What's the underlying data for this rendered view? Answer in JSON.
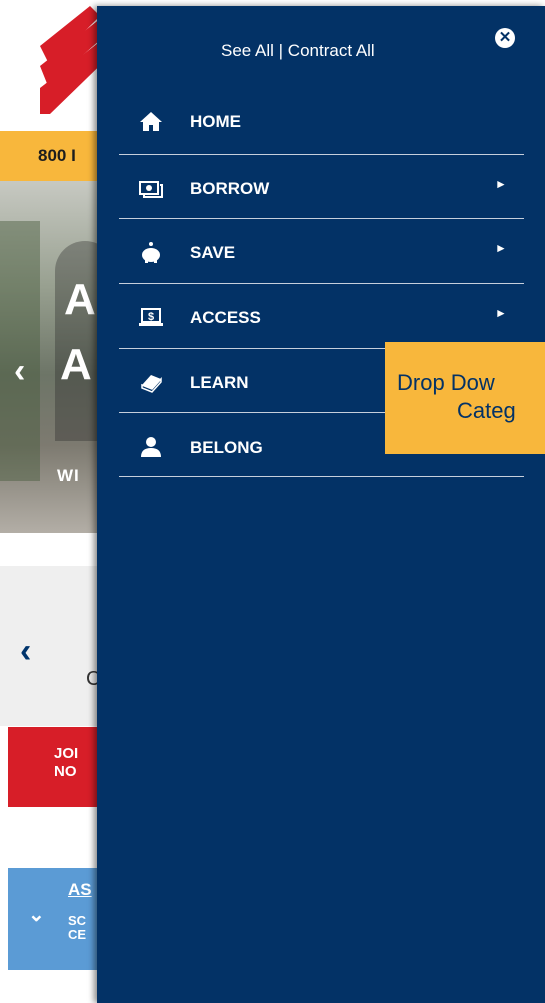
{
  "background": {
    "phone_text": "800 I",
    "hero_big1": "A",
    "hero_big2": "A",
    "hero_small": "WI",
    "grey_letter": "C",
    "join_line1": "JOI",
    "join_line2": "NO",
    "blue_title": "AS",
    "blue_sub1": "SC",
    "blue_sub2": "CE"
  },
  "menu": {
    "header": "See All | Contract All",
    "close_glyph": "✕",
    "items": [
      {
        "label": "HOME",
        "icon": "home-icon",
        "glyph": "⌂",
        "has_submenu": false
      },
      {
        "label": "BORROW",
        "icon": "money-icon",
        "glyph": "▣",
        "has_submenu": true
      },
      {
        "label": "SAVE",
        "icon": "piggy-bank-icon",
        "glyph": "●",
        "has_submenu": true
      },
      {
        "label": "ACCESS",
        "icon": "laptop-dollar-icon",
        "glyph": "$",
        "has_submenu": true
      },
      {
        "label": "LEARN",
        "icon": "book-icon",
        "glyph": "▰",
        "has_submenu": false
      },
      {
        "label": "BELONG",
        "icon": "user-icon",
        "glyph": "●",
        "has_submenu": false
      }
    ],
    "submenu_arrow": "►"
  },
  "tooltip": {
    "line1": "Drop Dow",
    "line2": "Categ"
  },
  "colors": {
    "panel": "#033266",
    "accent_yellow": "#f8b73c",
    "accent_red": "#d71e28",
    "accent_blue": "#5b9bd5"
  }
}
